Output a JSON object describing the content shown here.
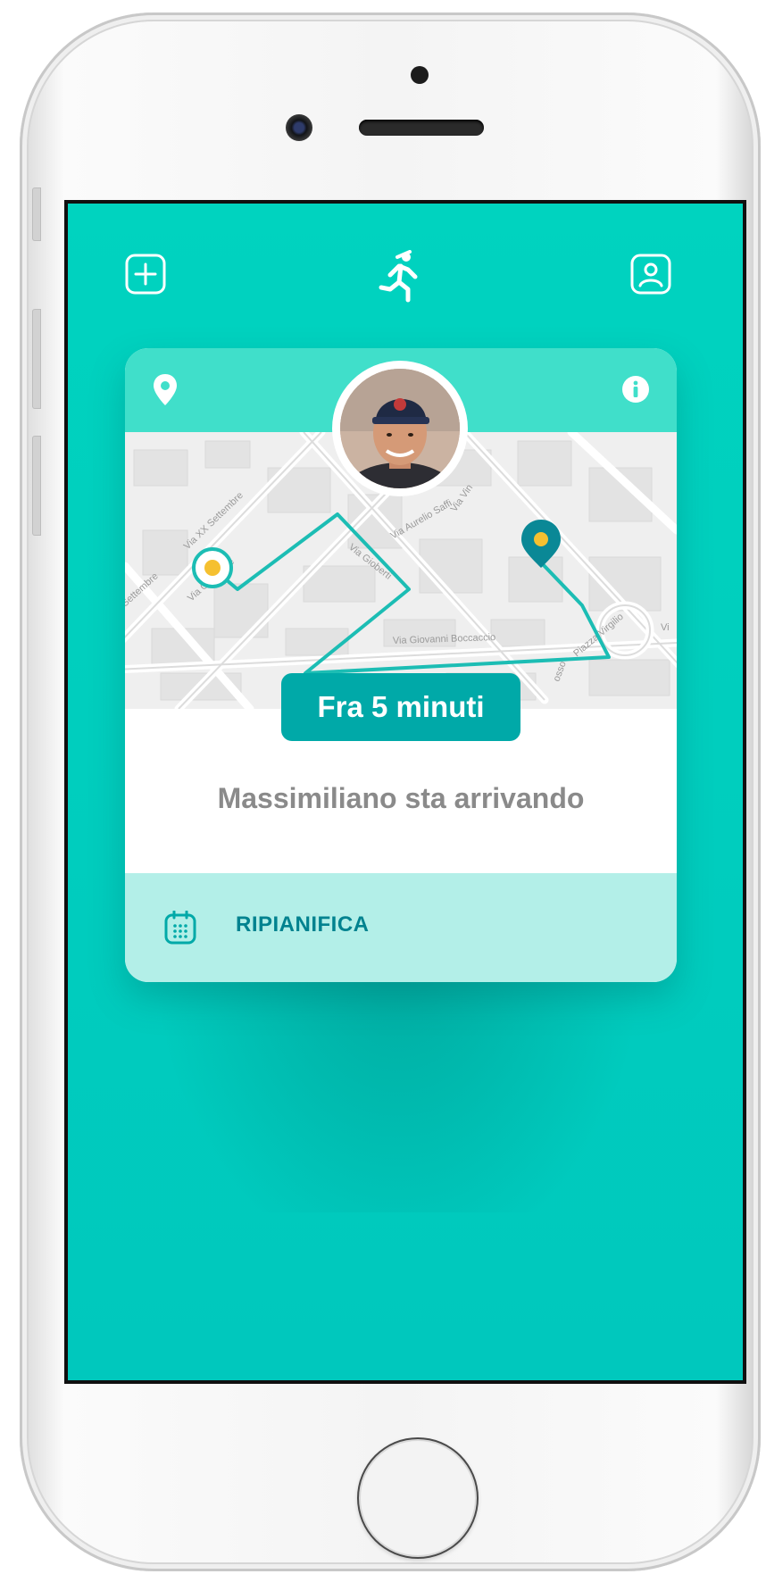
{
  "header": {
    "add_icon": "plus-square-icon",
    "logo_icon": "runner-icon",
    "profile_icon": "user-square-icon"
  },
  "card": {
    "location_icon": "map-pin-icon",
    "info_icon": "info-icon",
    "eta_label": "Fra 5 minuti",
    "status": "Massimiliano sta arrivando",
    "reschedule_label": "RIPIANIFICA",
    "reschedule_icon": "calendar-icon"
  },
  "map": {
    "streets": [
      "Settembre",
      "Via XX Settembre",
      "Via Giuseppe",
      "Via Aurelio Saffi",
      "Via Vin",
      "Via Gioberti",
      "Via Giovanni Boccaccio",
      "Piazza Virgilio",
      "osso",
      "Vi"
    ]
  },
  "colors": {
    "screen_bg": "#00d3bf",
    "card_header": "#40dfca",
    "route": "#1cbdb4",
    "eta_badge": "#00a9a8",
    "reschedule_bg": "#b3efe8",
    "reschedule_text": "#00828f",
    "destination_pin": "#0a8896",
    "marker_dot": "#f5c030"
  }
}
